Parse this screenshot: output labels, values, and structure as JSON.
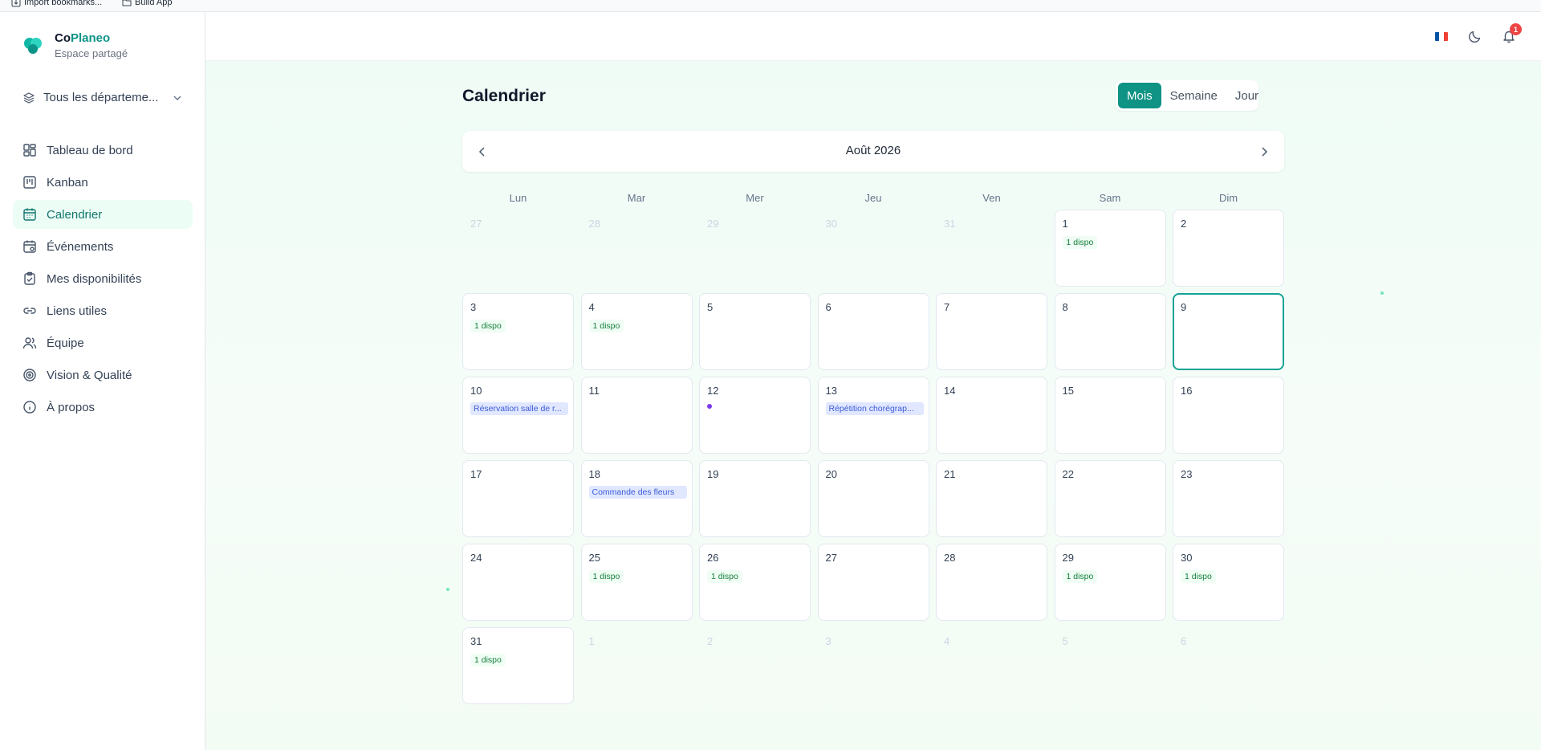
{
  "browser": {
    "bookmarks": [
      "Import bookmarks...",
      "Build App"
    ]
  },
  "brand": {
    "name_prefix": "Co",
    "name_accent": "Planeo",
    "subtitle": "Espace partagé"
  },
  "department_selector": {
    "label": "Tous les départeme..."
  },
  "nav": [
    {
      "label": "Tableau de bord",
      "icon": "dashboard-icon"
    },
    {
      "label": "Kanban",
      "icon": "kanban-icon"
    },
    {
      "label": "Calendrier",
      "icon": "calendar-icon",
      "active": true
    },
    {
      "label": "Événements",
      "icon": "calendar-event-icon"
    },
    {
      "label": "Mes disponibilités",
      "icon": "clipboard-check-icon"
    },
    {
      "label": "Liens utiles",
      "icon": "link-icon"
    },
    {
      "label": "Équipe",
      "icon": "users-icon"
    },
    {
      "label": "Vision & Qualité",
      "icon": "target-icon"
    },
    {
      "label": "À propos",
      "icon": "info-icon"
    }
  ],
  "topbar": {
    "notifications_count": "1",
    "language": "fr",
    "flag_colors": [
      "#0055a4",
      "#ffffff",
      "#ef4135"
    ]
  },
  "page": {
    "title": "Calendrier",
    "views": [
      "Mois",
      "Semaine",
      "Jour"
    ],
    "active_view": "Mois",
    "month_label": "Août 2026"
  },
  "calendar": {
    "weekdays": [
      "Lun",
      "Mar",
      "Mer",
      "Jeu",
      "Ven",
      "Sam",
      "Dim"
    ],
    "weeks": [
      [
        {
          "day": "27",
          "outside": true
        },
        {
          "day": "28",
          "outside": true
        },
        {
          "day": "29",
          "outside": true
        },
        {
          "day": "30",
          "outside": true
        },
        {
          "day": "31",
          "outside": true
        },
        {
          "day": "1",
          "badge": "1 dispo"
        },
        {
          "day": "2"
        }
      ],
      [
        {
          "day": "3",
          "badge": "1 dispo"
        },
        {
          "day": "4",
          "badge": "1 dispo"
        },
        {
          "day": "5"
        },
        {
          "day": "6"
        },
        {
          "day": "7"
        },
        {
          "day": "8"
        },
        {
          "day": "9",
          "today": true
        }
      ],
      [
        {
          "day": "10",
          "event": "Réservation salle de r..."
        },
        {
          "day": "11"
        },
        {
          "day": "12",
          "dot": true
        },
        {
          "day": "13",
          "event": "Répétition chorégrap..."
        },
        {
          "day": "14"
        },
        {
          "day": "15"
        },
        {
          "day": "16"
        }
      ],
      [
        {
          "day": "17"
        },
        {
          "day": "18",
          "event": "Commande des fleurs"
        },
        {
          "day": "19"
        },
        {
          "day": "20"
        },
        {
          "day": "21"
        },
        {
          "day": "22"
        },
        {
          "day": "23"
        }
      ],
      [
        {
          "day": "24"
        },
        {
          "day": "25",
          "badge": "1 dispo"
        },
        {
          "day": "26",
          "badge": "1 dispo"
        },
        {
          "day": "27"
        },
        {
          "day": "28"
        },
        {
          "day": "29",
          "badge": "1 dispo"
        },
        {
          "day": "30",
          "badge": "1 dispo"
        }
      ],
      [
        {
          "day": "31",
          "badge": "1 dispo"
        },
        {
          "day": "1",
          "outside": true
        },
        {
          "day": "2",
          "outside": true
        },
        {
          "day": "3",
          "outside": true
        },
        {
          "day": "4",
          "outside": true
        },
        {
          "day": "5",
          "outside": true
        },
        {
          "day": "6",
          "outside": true
        }
      ]
    ]
  }
}
